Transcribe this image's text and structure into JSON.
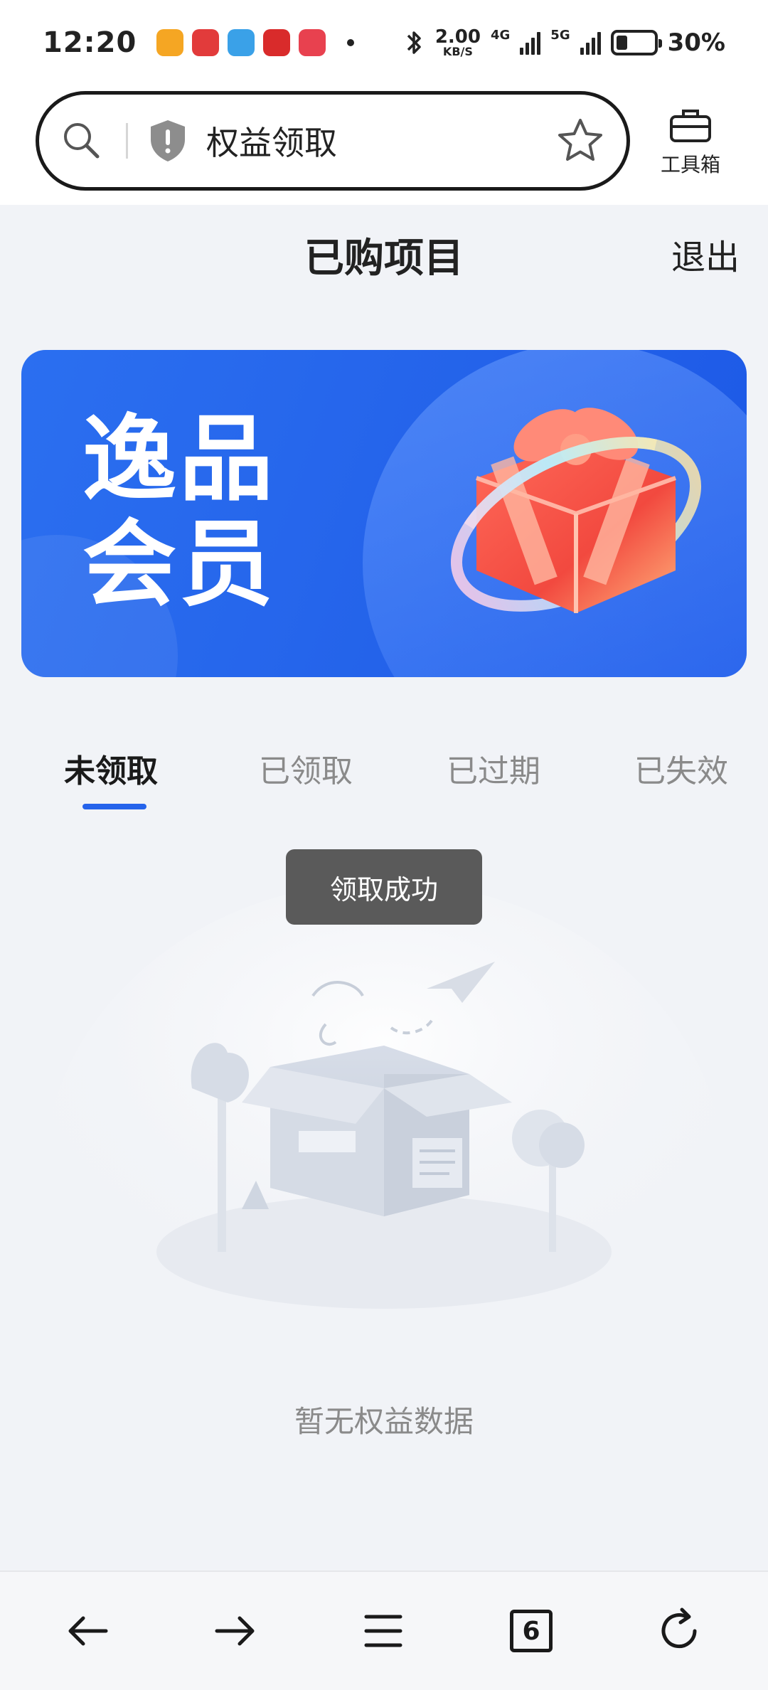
{
  "status_bar": {
    "time": "12:20",
    "net_speed_value": "2.00",
    "net_speed_unit": "KB/S",
    "net_type_1": "4G",
    "net_type_2": "5G",
    "battery_percent": "30%",
    "battery_level": 0.3,
    "app_icons": [
      "weibo-icon",
      "ifeng-icon",
      "telegram-icon",
      "cctv-icon",
      "video-player-icon"
    ]
  },
  "browser": {
    "address_text": "权益领取",
    "toolbox_label": "工具箱"
  },
  "page": {
    "title": "已购项目",
    "logout_label": "退出"
  },
  "banner": {
    "line1": "逸品",
    "line2": "会员"
  },
  "tabs": {
    "items": [
      {
        "label": "未领取",
        "active": true
      },
      {
        "label": "已领取",
        "active": false
      },
      {
        "label": "已过期",
        "active": false
      },
      {
        "label": "已失效",
        "active": false
      }
    ]
  },
  "toast": {
    "text": "领取成功"
  },
  "empty_state": {
    "text": "暂无权益数据"
  },
  "bottom_nav": {
    "tab_count": "6"
  },
  "colors": {
    "accent": "#2563eb",
    "banner_blue": "#2463ea",
    "toast_bg": "#5a5a5a",
    "page_bg": "#f1f3f7"
  }
}
